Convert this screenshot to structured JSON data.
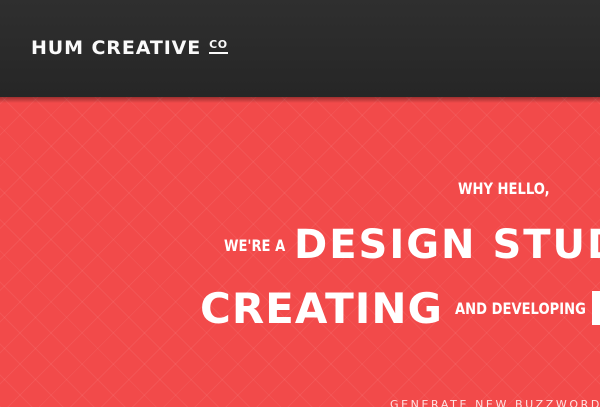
{
  "header": {
    "logo_text": "HUM CREATIVE",
    "logo_suffix": "CO"
  },
  "hero": {
    "greeting": "WHY HELLO,",
    "intro": "WE'RE A",
    "headline": "DESIGN STUD",
    "verb": "CREATING",
    "connector": "AND DEVELOPING",
    "cta": "GENERATE NEW BUZZWORDS"
  },
  "colors": {
    "header_bg": "#2b2b2b",
    "hero_bg": "#f24a4a",
    "text": "#ffffff"
  }
}
